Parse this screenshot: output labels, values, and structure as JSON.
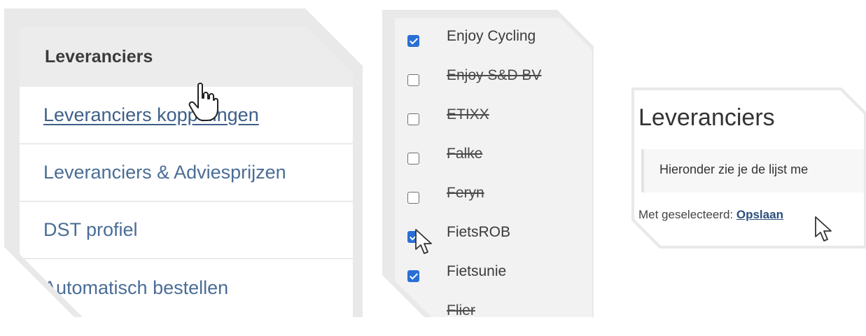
{
  "panel_menu": {
    "header": "Leveranciers",
    "items": [
      {
        "label": "Leveranciers koppelingen"
      },
      {
        "label": "Leveranciers & Adviesprijzen"
      },
      {
        "label": "DST profiel"
      },
      {
        "label": "Automatisch bestellen"
      }
    ]
  },
  "panel_suppliers": {
    "items": [
      {
        "label": "Enjoy Cycling",
        "checked": true,
        "strikethrough": false
      },
      {
        "label": "Enjoy S&D BV",
        "checked": false,
        "strikethrough": true
      },
      {
        "label": "ETIXX",
        "checked": false,
        "strikethrough": true
      },
      {
        "label": "Falke",
        "checked": false,
        "strikethrough": true
      },
      {
        "label": "Feryn",
        "checked": false,
        "strikethrough": true
      },
      {
        "label": "FietsROB",
        "checked": true,
        "strikethrough": false
      },
      {
        "label": "Fietsunie",
        "checked": true,
        "strikethrough": false
      },
      {
        "label": "Flier",
        "checked": false,
        "strikethrough": true
      }
    ]
  },
  "panel_save": {
    "title": "Leveranciers",
    "info_text": "Hieronder zie je de lijst me",
    "selected_prefix": "Met geselecteerd:",
    "save_label": "Opslaan"
  },
  "colors": {
    "link": "#3e5f88",
    "checkbox_checked": "#2a6fd6",
    "panel_frame": "#e9e9e9"
  },
  "icons": [
    "hand-pointer-icon",
    "arrow-cursor-icon"
  ]
}
